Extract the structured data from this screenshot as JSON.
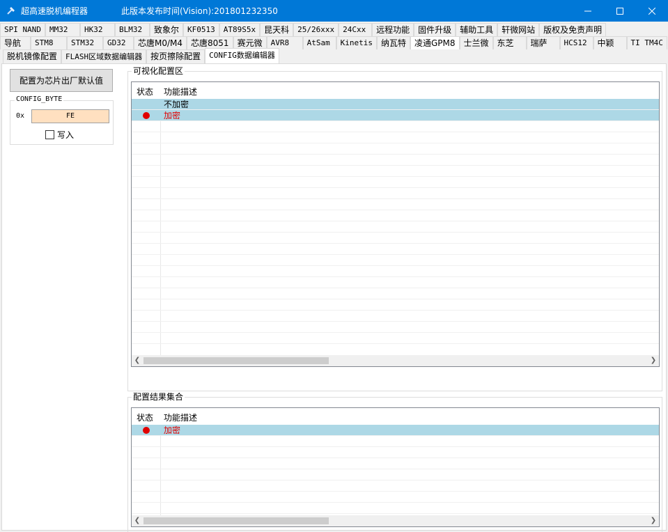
{
  "window": {
    "title": "超高速脱机编程器",
    "version": "此版本发布时间(Vision):201801232350"
  },
  "tabs_row1": [
    "SPI NAND",
    "MM32",
    "HK32",
    "BLM32",
    "致象尔",
    "KF0513",
    "AT89S5x",
    "昆天科",
    "25/26xxx",
    "24Cxx",
    "远程功能",
    "固件升级",
    "辅助工具",
    "轩微网站",
    "版权及免责声明"
  ],
  "tabs_row2": [
    "导航",
    "STM8",
    "STM32",
    "GD32",
    "芯唐M0/M4",
    "芯唐8051",
    "赛元微",
    "AVR8",
    "AtSam",
    "Kinetis",
    "纳瓦特",
    "凌通GPM8",
    "士兰微",
    "东芝",
    "瑞萨",
    "HCS12",
    "中颖",
    "TI TM4C"
  ],
  "subtabs": [
    "脱机镜像配置",
    "FLASH区域数据编辑器",
    "按页擦除配置",
    "CONFIG数据编辑器"
  ],
  "left": {
    "factory_button": "配置为芯片出厂默认值",
    "group_label": "CONFIG_BYTE",
    "prefix": "0x",
    "value": "FE",
    "write_label": "写入"
  },
  "visual": {
    "label": "可视化配置区",
    "col_status": "状态",
    "col_desc": "功能描述",
    "rows": [
      {
        "desc": "不加密"
      },
      {
        "desc": "加密"
      }
    ]
  },
  "result": {
    "label": "配置结果集合",
    "col_status": "状态",
    "col_desc": "功能描述",
    "rows": [
      {
        "desc": "加密"
      }
    ]
  }
}
